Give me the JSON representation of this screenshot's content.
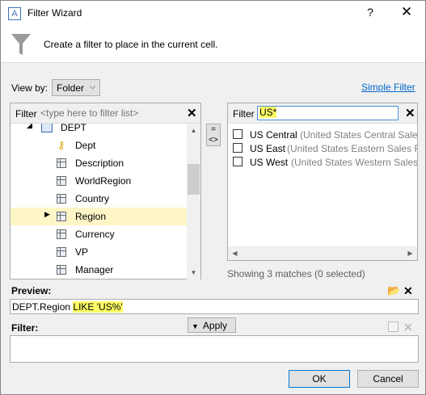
{
  "window": {
    "title": "Filter Wizard",
    "app_icon_glyph": "A",
    "help_label": "?",
    "close_label": "✕"
  },
  "header": {
    "text": "Create a filter to place in the current cell."
  },
  "view_by": {
    "label": "View by:",
    "value": "Folder"
  },
  "simple_filter_link": "Simple Filter",
  "left_panel": {
    "filter_label": "Filter",
    "filter_placeholder": "<type here to filter list>",
    "clear_label": "✕",
    "tree": [
      {
        "label": "DEPT",
        "icon": "table-icon",
        "expanded": true
      },
      {
        "label": "Dept",
        "icon": "key-icon"
      },
      {
        "label": "Description",
        "icon": "column-icon"
      },
      {
        "label": "WorldRegion",
        "icon": "column-icon"
      },
      {
        "label": "Country",
        "icon": "column-icon"
      },
      {
        "label": "Region",
        "icon": "column-icon",
        "selected": true
      },
      {
        "label": "Currency",
        "icon": "column-icon"
      },
      {
        "label": "VP",
        "icon": "column-icon"
      },
      {
        "label": "Manager",
        "icon": "column-icon"
      }
    ]
  },
  "mid_buttons": {
    "equals": "=",
    "not_equals": "<>"
  },
  "right_panel": {
    "filter_label": "Filter",
    "filter_value": "US*",
    "clear_label": "✕",
    "values": [
      {
        "name": "US Central",
        "desc": "(United States Central Sales"
      },
      {
        "name": "US East",
        "desc": "(United States Eastern Sales Re"
      },
      {
        "name": "US West",
        "desc": "(United States Western Sales I"
      }
    ]
  },
  "matches_text": "Showing 3 matches (0 selected)",
  "preview": {
    "label": "Preview:",
    "field": "DEPT.Region",
    "expr": "LIKE 'US%'"
  },
  "filter_section": {
    "label": "Filter:",
    "apply_label": "Apply",
    "value": ""
  },
  "buttons": {
    "ok": "OK",
    "cancel": "Cancel"
  },
  "colors": {
    "highlight": "#ffff66",
    "selected_row": "#fff6c8",
    "link": "#0066cc"
  }
}
